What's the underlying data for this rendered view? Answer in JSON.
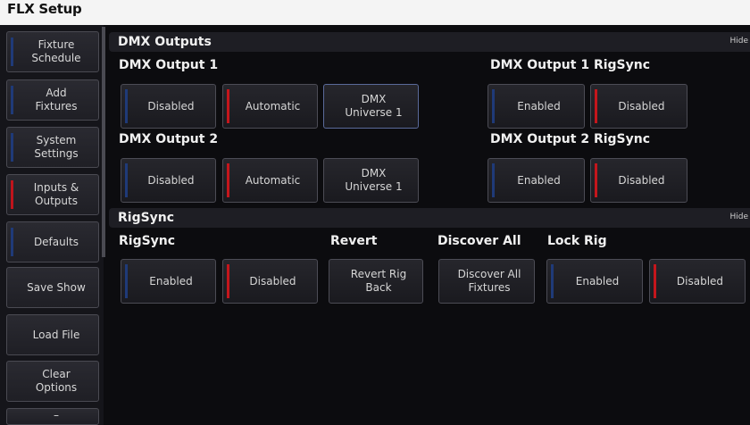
{
  "app": {
    "title": "FLX Setup"
  },
  "sidebar": {
    "items": [
      {
        "label": "Fixture\nSchedule"
      },
      {
        "label": "Add\nFixtures"
      },
      {
        "label": "System\nSettings"
      },
      {
        "label": "Inputs &\nOutputs"
      },
      {
        "label": "Defaults"
      },
      {
        "label": "Save Show"
      },
      {
        "label": "Load File"
      },
      {
        "label": "Clear\nOptions"
      },
      {
        "label": "–"
      }
    ]
  },
  "dmx_section": {
    "title": "DMX Outputs",
    "hide_label": "Hide",
    "output1": {
      "label": "DMX Output 1",
      "buttons": {
        "disabled": "Disabled",
        "automatic": "Automatic",
        "universe": "DMX\nUniverse 1"
      }
    },
    "output1_rigsync": {
      "label": "DMX Output 1 RigSync",
      "buttons": {
        "enabled": "Enabled",
        "disabled": "Disabled"
      }
    },
    "output2": {
      "label": "DMX Output 2",
      "buttons": {
        "disabled": "Disabled",
        "automatic": "Automatic",
        "universe": "DMX\nUniverse 1"
      }
    },
    "output2_rigsync": {
      "label": "DMX Output 2 RigSync",
      "buttons": {
        "enabled": "Enabled",
        "disabled": "Disabled"
      }
    }
  },
  "rigsync_section": {
    "title": "RigSync",
    "hide_label": "Hide",
    "rigsync": {
      "label": "RigSync",
      "buttons": {
        "enabled": "Enabled",
        "disabled": "Disabled"
      }
    },
    "revert": {
      "label": "Revert",
      "button": "Revert Rig\nBack"
    },
    "discover": {
      "label": "Discover All",
      "button": "Discover All\nFixtures"
    },
    "lock_rig": {
      "label": "Lock Rig",
      "buttons": {
        "enabled": "Enabled",
        "disabled": "Disabled"
      }
    }
  },
  "colors": {
    "active_indicator": "#c4161c",
    "inactive_indicator": "#1f3a78"
  }
}
